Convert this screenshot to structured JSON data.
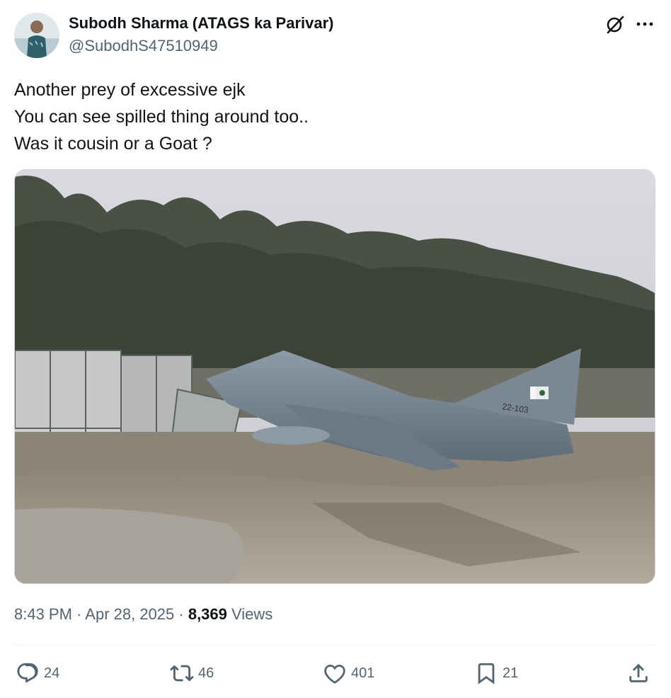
{
  "author": {
    "display_name": "Subodh Sharma (ATAGS ka Parivar)",
    "handle": "@SubodhS47510949",
    "avatar_icon": "user-avatar"
  },
  "header_icons": {
    "grok": "grok-icon",
    "more": "more-options-icon"
  },
  "post": {
    "lines": [
      "Another prey of excessive ejk",
      "You can see spilled thing around too..",
      "Was it cousin or a Goat ?"
    ],
    "aircraft_marking": "22-103"
  },
  "meta": {
    "time": "8:43 PM",
    "separator1": " · ",
    "date": "Apr 28, 2025",
    "separator2": " · ",
    "views_count": "8,369",
    "views_label": " Views"
  },
  "actions": {
    "replies": "24",
    "reposts": "46",
    "likes": "401",
    "bookmarks": "21"
  },
  "colors": {
    "text_primary": "#0f1419",
    "text_secondary": "#536471",
    "divider": "#eff3f4"
  }
}
